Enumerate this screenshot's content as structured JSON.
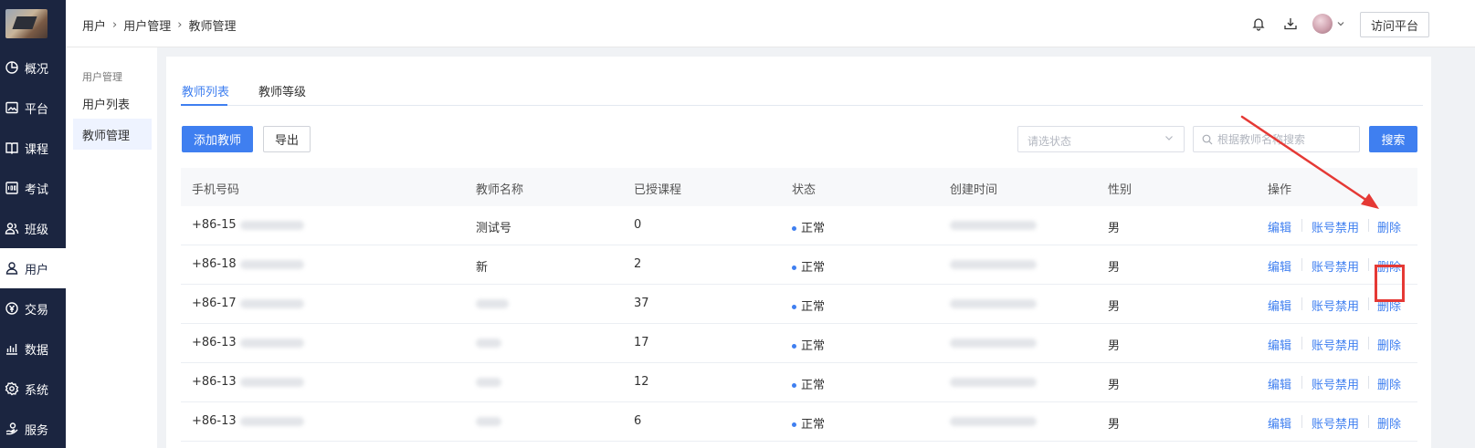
{
  "sidebar": {
    "items": [
      {
        "label": "概况",
        "icon": "pie-chart-icon"
      },
      {
        "label": "平台",
        "icon": "image-icon"
      },
      {
        "label": "课程",
        "icon": "book-icon"
      },
      {
        "label": "考试",
        "icon": "exam-score-icon"
      },
      {
        "label": "班级",
        "icon": "users-icon"
      },
      {
        "label": "用户",
        "icon": "user-icon",
        "active": true
      },
      {
        "label": "交易",
        "icon": "currency-icon"
      },
      {
        "label": "数据",
        "icon": "bar-chart-icon"
      },
      {
        "label": "系统",
        "icon": "gear-icon"
      },
      {
        "label": "服务",
        "icon": "service-icon"
      }
    ]
  },
  "header": {
    "breadcrumb": [
      "用户",
      "用户管理",
      "教师管理"
    ],
    "visit_button": "访问平台",
    "icons": [
      "bell-icon",
      "download-icon",
      "avatar",
      "chevron-down-icon"
    ]
  },
  "subnav": {
    "title": "用户管理",
    "items": [
      {
        "label": "用户列表"
      },
      {
        "label": "教师管理",
        "active": true
      }
    ]
  },
  "tabs": [
    {
      "label": "教师列表",
      "active": true
    },
    {
      "label": "教师等级"
    }
  ],
  "toolbar": {
    "add_button": "添加教师",
    "export_button": "导出",
    "status_placeholder": "请选状态",
    "search_placeholder": "根据教师名称搜索",
    "search_button": "搜索"
  },
  "table": {
    "columns": [
      "手机号码",
      "教师名称",
      "已授课程",
      "状态",
      "创建时间",
      "性别",
      "操作"
    ],
    "rows": [
      {
        "phone": "+86-15",
        "name": "测试号",
        "courses": "0",
        "status": "正常",
        "gender": "男"
      },
      {
        "phone": "+86-18",
        "name": "新",
        "courses": "2",
        "status": "正常",
        "gender": "男"
      },
      {
        "phone": "+86-17",
        "name": "",
        "courses": "37",
        "status": "正常",
        "gender": "男"
      },
      {
        "phone": "+86-13",
        "name": "",
        "courses": "17",
        "status": "正常",
        "gender": "男"
      },
      {
        "phone": "+86-13",
        "name": "",
        "courses": "12",
        "status": "正常",
        "gender": "男"
      },
      {
        "phone": "+86-13",
        "name": "",
        "courses": "6",
        "status": "正常",
        "gender": "男"
      }
    ],
    "actions": [
      "编辑",
      "账号禁用",
      "删除"
    ]
  },
  "colors": {
    "sidebar_bg": "#1b2540",
    "accent": "#3f7ff0",
    "annotation": "#e53935"
  }
}
